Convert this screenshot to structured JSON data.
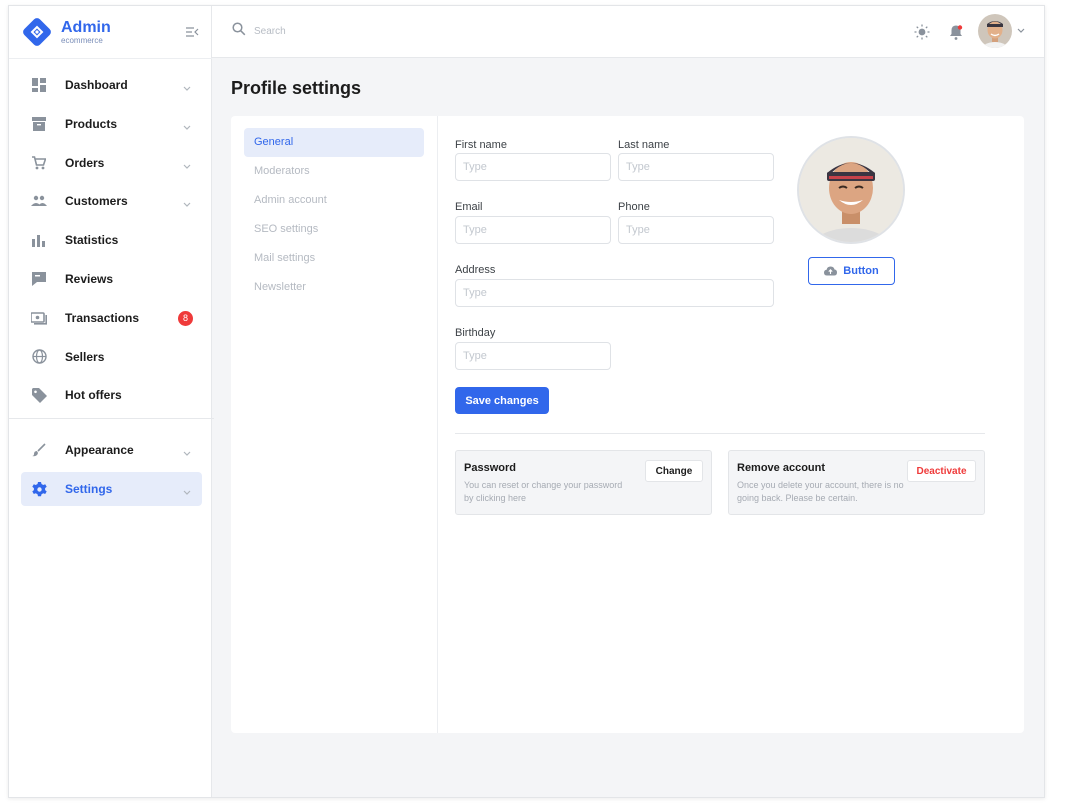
{
  "brand": {
    "name": "Admin",
    "subtitle": "ecommerce",
    "accent": "#3167eb"
  },
  "header": {
    "search_placeholder": "Search",
    "icons": [
      "search-icon",
      "sun-icon",
      "bell-icon",
      "chevron-down-icon"
    ]
  },
  "sidebar": {
    "items": [
      {
        "label": "Dashboard",
        "icon": "dashboard-icon",
        "has_chevron": true
      },
      {
        "label": "Products",
        "icon": "archive-box-icon",
        "has_chevron": true
      },
      {
        "label": "Orders",
        "icon": "cart-icon",
        "has_chevron": true
      },
      {
        "label": "Customers",
        "icon": "people-icon",
        "has_chevron": true
      },
      {
        "label": "Statistics",
        "icon": "bar-chart-icon",
        "has_chevron": false
      },
      {
        "label": "Reviews",
        "icon": "comment-icon",
        "has_chevron": false
      },
      {
        "label": "Transactions",
        "icon": "money-icon",
        "badge": "8"
      },
      {
        "label": "Sellers",
        "icon": "globe-icon",
        "has_chevron": false
      },
      {
        "label": "Hot offers",
        "icon": "tag-icon",
        "has_chevron": false
      }
    ],
    "secondary": [
      {
        "label": "Appearance",
        "icon": "brush-icon",
        "has_chevron": true
      },
      {
        "label": "Settings",
        "icon": "gear-icon",
        "has_chevron": true,
        "active": true
      }
    ]
  },
  "page": {
    "title": "Profile settings"
  },
  "settings_nav": [
    {
      "label": "General",
      "active": true
    },
    {
      "label": "Moderators"
    },
    {
      "label": "Admin account"
    },
    {
      "label": "SEO settings"
    },
    {
      "label": "Mail settings"
    },
    {
      "label": "Newsletter"
    }
  ],
  "form": {
    "first_name": {
      "label": "First name",
      "placeholder": "Type",
      "value": ""
    },
    "last_name": {
      "label": "Last name",
      "placeholder": "Type",
      "value": ""
    },
    "email": {
      "label": "Email",
      "placeholder": "Type",
      "value": ""
    },
    "phone": {
      "label": "Phone",
      "placeholder": "Type",
      "value": ""
    },
    "address": {
      "label": "Address",
      "placeholder": "Type",
      "value": ""
    },
    "birthday": {
      "label": "Birthday",
      "placeholder": "Type",
      "value": ""
    },
    "upload_label": "Button",
    "save_label": "Save changes"
  },
  "password_panel": {
    "title": "Password",
    "description": "You can reset or change your password by clicking here",
    "button": "Change"
  },
  "remove_panel": {
    "title": "Remove account",
    "description": "Once you delete your account, there is no going back. Please be certain.",
    "button": "Deactivate",
    "danger_color": "#ef3a3a"
  }
}
